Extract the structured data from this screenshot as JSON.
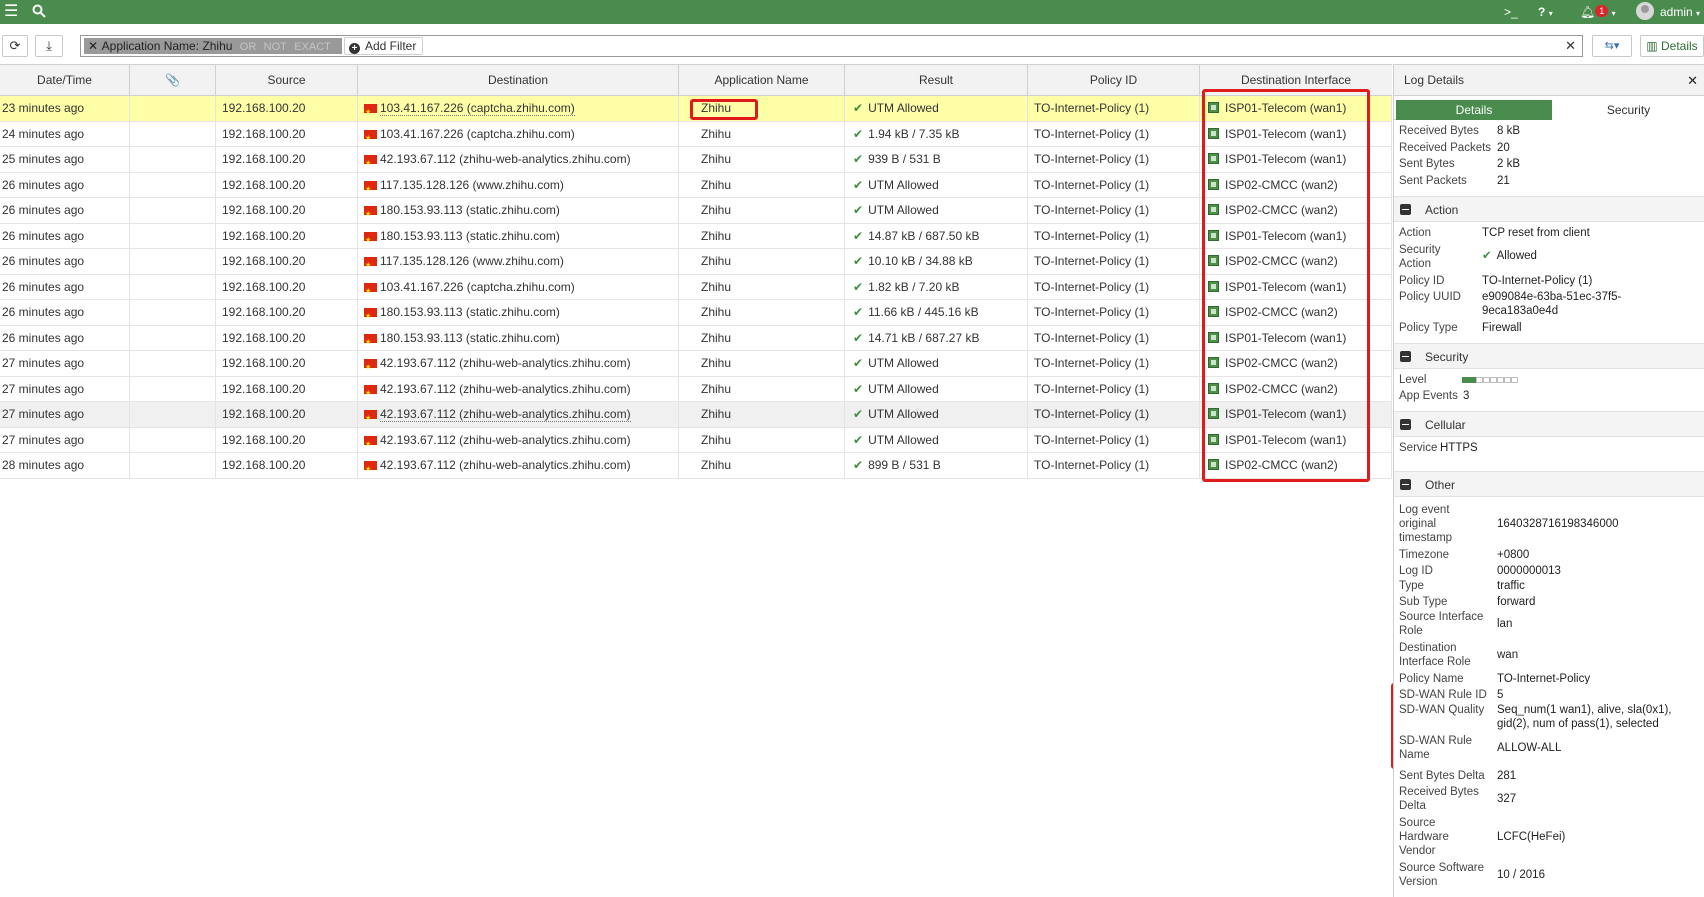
{
  "topbar": {
    "menu_icon": "hamburger-icon",
    "search_icon": "search-icon",
    "cli_label": ">_",
    "help_label": "?",
    "notification_count": "1",
    "user": "admin"
  },
  "toolbar": {
    "refresh_icon": "refresh-icon",
    "download_icon": "download-icon",
    "filter": {
      "field": "Application Name:",
      "value": "Zhihu",
      "modifiers": [
        "OR",
        "NOT",
        "EXACT"
      ],
      "add_filter_label": "Add Filter",
      "clear_label": "✕"
    },
    "view_label": "⇆▾",
    "details_label": "Details"
  },
  "table": {
    "columns": [
      "Date/Time",
      "📎",
      "Source",
      "Destination",
      "Application Name",
      "Result",
      "Policy ID",
      "Destination Interface"
    ],
    "rows": [
      {
        "time": "23 minutes ago",
        "source": "192.168.100.20",
        "dest": "103.41.167.226 (captcha.zhihu.com)",
        "app": "Zhihu",
        "result": "UTM Allowed",
        "policy": "TO-Internet-Policy (1)",
        "iface": "ISP01-Telecom (wan1)"
      },
      {
        "time": "24 minutes ago",
        "source": "192.168.100.20",
        "dest": "103.41.167.226 (captcha.zhihu.com)",
        "app": "Zhihu",
        "result": "1.94 kB / 7.35 kB",
        "policy": "TO-Internet-Policy (1)",
        "iface": "ISP01-Telecom (wan1)"
      },
      {
        "time": "25 minutes ago",
        "source": "192.168.100.20",
        "dest": "42.193.67.112 (zhihu-web-analytics.zhihu.com)",
        "app": "Zhihu",
        "result": "939 B / 531 B",
        "policy": "TO-Internet-Policy (1)",
        "iface": "ISP01-Telecom (wan1)"
      },
      {
        "time": "26 minutes ago",
        "source": "192.168.100.20",
        "dest": "117.135.128.126 (www.zhihu.com)",
        "app": "Zhihu",
        "result": "UTM Allowed",
        "policy": "TO-Internet-Policy (1)",
        "iface": "ISP02-CMCC (wan2)"
      },
      {
        "time": "26 minutes ago",
        "source": "192.168.100.20",
        "dest": "180.153.93.113 (static.zhihu.com)",
        "app": "Zhihu",
        "result": "UTM Allowed",
        "policy": "TO-Internet-Policy (1)",
        "iface": "ISP02-CMCC (wan2)"
      },
      {
        "time": "26 minutes ago",
        "source": "192.168.100.20",
        "dest": "180.153.93.113 (static.zhihu.com)",
        "app": "Zhihu",
        "result": "14.87 kB / 687.50 kB",
        "policy": "TO-Internet-Policy (1)",
        "iface": "ISP01-Telecom (wan1)"
      },
      {
        "time": "26 minutes ago",
        "source": "192.168.100.20",
        "dest": "117.135.128.126 (www.zhihu.com)",
        "app": "Zhihu",
        "result": "10.10 kB / 34.88 kB",
        "policy": "TO-Internet-Policy (1)",
        "iface": "ISP02-CMCC (wan2)"
      },
      {
        "time": "26 minutes ago",
        "source": "192.168.100.20",
        "dest": "103.41.167.226 (captcha.zhihu.com)",
        "app": "Zhihu",
        "result": "1.82 kB / 7.20 kB",
        "policy": "TO-Internet-Policy (1)",
        "iface": "ISP01-Telecom (wan1)"
      },
      {
        "time": "26 minutes ago",
        "source": "192.168.100.20",
        "dest": "180.153.93.113 (static.zhihu.com)",
        "app": "Zhihu",
        "result": "11.66 kB / 445.16 kB",
        "policy": "TO-Internet-Policy (1)",
        "iface": "ISP02-CMCC (wan2)"
      },
      {
        "time": "26 minutes ago",
        "source": "192.168.100.20",
        "dest": "180.153.93.113 (static.zhihu.com)",
        "app": "Zhihu",
        "result": "14.71 kB / 687.27 kB",
        "policy": "TO-Internet-Policy (1)",
        "iface": "ISP01-Telecom (wan1)"
      },
      {
        "time": "27 minutes ago",
        "source": "192.168.100.20",
        "dest": "42.193.67.112 (zhihu-web-analytics.zhihu.com)",
        "app": "Zhihu",
        "result": "UTM Allowed",
        "policy": "TO-Internet-Policy (1)",
        "iface": "ISP02-CMCC (wan2)"
      },
      {
        "time": "27 minutes ago",
        "source": "192.168.100.20",
        "dest": "42.193.67.112 (zhihu-web-analytics.zhihu.com)",
        "app": "Zhihu",
        "result": "UTM Allowed",
        "policy": "TO-Internet-Policy (1)",
        "iface": "ISP02-CMCC (wan2)"
      },
      {
        "time": "27 minutes ago",
        "source": "192.168.100.20",
        "dest": "42.193.67.112 (zhihu-web-analytics.zhihu.com)",
        "app": "Zhihu",
        "result": "UTM Allowed",
        "policy": "TO-Internet-Policy (1)",
        "iface": "ISP01-Telecom (wan1)"
      },
      {
        "time": "27 minutes ago",
        "source": "192.168.100.20",
        "dest": "42.193.67.112 (zhihu-web-analytics.zhihu.com)",
        "app": "Zhihu",
        "result": "UTM Allowed",
        "policy": "TO-Internet-Policy (1)",
        "iface": "ISP01-Telecom (wan1)"
      },
      {
        "time": "28 minutes ago",
        "source": "192.168.100.20",
        "dest": "42.193.67.112 (zhihu-web-analytics.zhihu.com)",
        "app": "Zhihu",
        "result": "899 B / 531 B",
        "policy": "TO-Internet-Policy (1)",
        "iface": "ISP02-CMCC (wan2)"
      }
    ]
  },
  "panel": {
    "title": "Log Details",
    "close_label": "✕",
    "tabs": [
      "Details",
      "Security"
    ],
    "top_rows": [
      {
        "k": "Received Bytes",
        "v": "8 kB"
      },
      {
        "k": "Received Packets",
        "v": "20"
      },
      {
        "k": "Sent Bytes",
        "v": "2 kB"
      },
      {
        "k": "Sent Packets",
        "v": "21"
      }
    ],
    "action": {
      "title": "Action",
      "action": {
        "k": "Action",
        "v": "TCP reset from client"
      },
      "security_action": {
        "k1": "Security",
        "k2": "Action",
        "v": "Allowed"
      },
      "policy_id": {
        "k": "Policy ID",
        "v": "TO-Internet-Policy (1)"
      },
      "policy_uuid": {
        "k": "Policy UUID",
        "v1": "e909084e-63ba-51ec-37f5-",
        "v2": "9eca183a0e4d"
      },
      "policy_type": {
        "k": "Policy Type",
        "v": "Firewall"
      }
    },
    "security": {
      "title": "Security",
      "level_label": "Level",
      "level_value": 1,
      "level_max": 7,
      "app_events_label": "App Events",
      "app_events_value": "3"
    },
    "cellular": {
      "title": "Cellular",
      "service_label": "Service",
      "service_value": "HTTPS"
    },
    "other": {
      "title": "Other",
      "log_event": {
        "k1": "Log event",
        "k2": "original",
        "k3": "timestamp",
        "v": "1640328716198346000"
      },
      "timezone": {
        "k": "Timezone",
        "v": "+0800"
      },
      "log_id": {
        "k": "Log ID",
        "v": "0000000013"
      },
      "type": {
        "k": "Type",
        "v": "traffic"
      },
      "sub_type": {
        "k": "Sub Type",
        "v": "forward"
      },
      "src_if_role": {
        "k1": "Source Interface",
        "k2": "Role",
        "v": "lan"
      },
      "dst_if_role": {
        "k1": "Destination",
        "k2": "Interface Role",
        "v": "wan"
      },
      "policy_name": {
        "k": "Policy Name",
        "v": "TO-Internet-Policy"
      },
      "sdwan_rule_id": {
        "k": "SD-WAN Rule ID",
        "v": "5"
      },
      "sdwan_quality": {
        "k": "SD-WAN Quality",
        "v1": "Seq_num(1 wan1), alive, sla(0x1),",
        "v2": "gid(2), num of pass(1), selected"
      },
      "sdwan_rule_name": {
        "k1": "SD-WAN Rule",
        "k2": "Name",
        "v": "ALLOW-ALL"
      },
      "sent_delta": {
        "k": "Sent Bytes Delta",
        "v": "281"
      },
      "recv_delta": {
        "k1": "Received Bytes",
        "k2": "Delta",
        "v": "327"
      },
      "hw_vendor": {
        "k1": "Source",
        "k2": "Hardware",
        "k3": "Vendor",
        "v": "LCFC(HeFei)"
      },
      "sw_version": {
        "k1": "Source Software",
        "k2": "Version",
        "v": "10 / 2016"
      }
    }
  },
  "colors": {
    "topbar": "#4a8c4e",
    "selected_row": "#ffffa8",
    "highlight": "#e01b1b",
    "check": "#3e8e41"
  }
}
